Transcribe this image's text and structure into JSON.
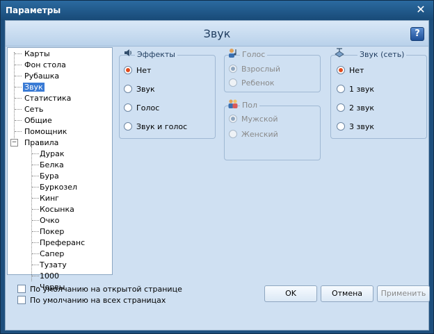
{
  "window": {
    "title": "Параметры"
  },
  "header": {
    "title": "Звук"
  },
  "tree": {
    "items": [
      "Карты",
      "Фон стола",
      "Рубашка",
      "Звук",
      "Статистика",
      "Сеть",
      "Общие",
      "Помощник",
      "Правила"
    ],
    "selected": "Звук",
    "rules_children": [
      "Дурак",
      "Белка",
      "Бура",
      "Буркозел",
      "Кинг",
      "Косынка",
      "Очко",
      "Покер",
      "Преферанс",
      "Сапер",
      "Тузату",
      "1000",
      "Червы"
    ],
    "toggle_symbol": "−"
  },
  "effects": {
    "title": "Эффекты",
    "options": [
      "Нет",
      "Звук",
      "Голос",
      "Звук и голос"
    ],
    "selected": "Нет"
  },
  "voice": {
    "title": "Голос",
    "options": [
      "Взрослый",
      "Ребенок"
    ],
    "selected": "Взрослый",
    "disabled": true
  },
  "gender": {
    "title": "Пол",
    "options": [
      "Мужской",
      "Женский"
    ],
    "selected": "Мужской",
    "disabled": true
  },
  "netsound": {
    "title": "Звук (сеть)",
    "options": [
      "Нет",
      "1 звук",
      "2 звук",
      "3 звук"
    ],
    "selected": "Нет"
  },
  "checkboxes": [
    "По умолчанию на открытой странице",
    "По умолчанию на всех страницах"
  ],
  "buttons": {
    "ok": "OK",
    "cancel": "Отмена",
    "apply": "Применить"
  },
  "glyphs": {
    "close": "✕",
    "help": "?"
  },
  "icons": {
    "effects": "speaker-icon",
    "voice": "voice-icon",
    "gender": "gender-icon",
    "netsound": "network-sound-icon"
  },
  "colors": {
    "accent": "#3a7bd5",
    "radio_selected": "#e04a1c",
    "titlebar": "#1e4f7d"
  }
}
